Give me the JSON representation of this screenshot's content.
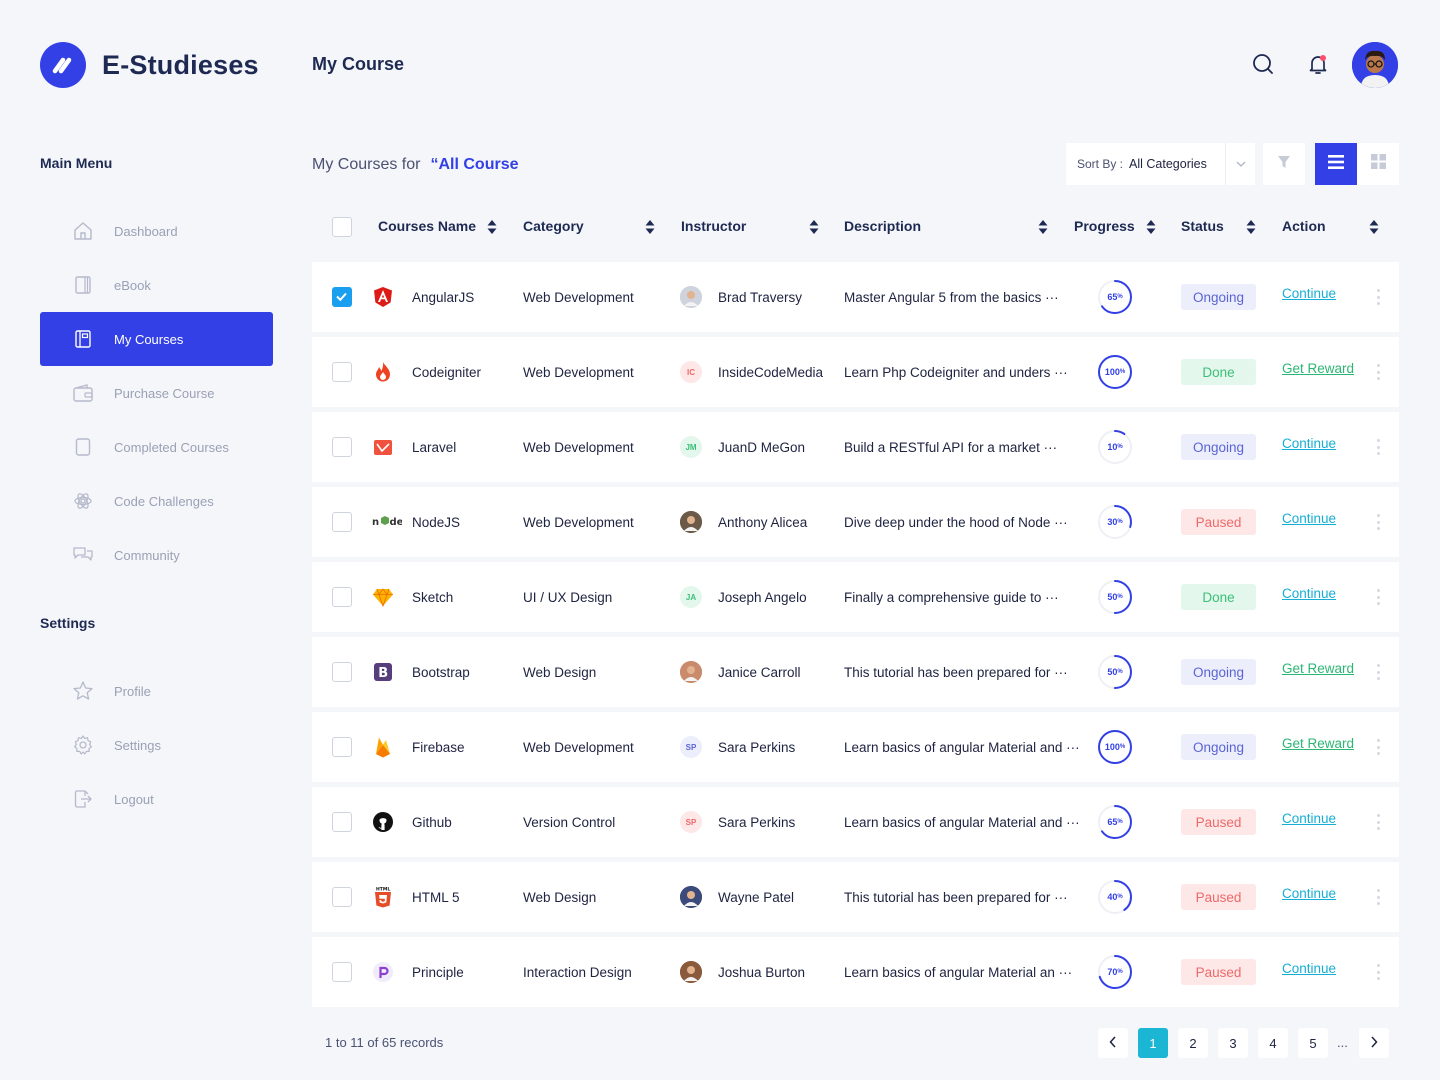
{
  "app": {
    "name": "E-Studieses"
  },
  "header": {
    "title": "My Course",
    "search_icon": "search-icon",
    "bell_icon": "bell-icon"
  },
  "sidebar": {
    "main_heading": "Main Menu",
    "main_items": [
      {
        "label": "Dashboard",
        "icon": "home-icon",
        "active": false
      },
      {
        "label": "eBook",
        "icon": "book-icon",
        "active": false
      },
      {
        "label": "My Courses",
        "icon": "notebook-icon",
        "active": true
      },
      {
        "label": "Purchase Course",
        "icon": "wallet-icon",
        "active": false
      },
      {
        "label": "Completed Courses",
        "icon": "document-icon",
        "active": false
      },
      {
        "label": "Code Challenges",
        "icon": "atom-icon",
        "active": false
      },
      {
        "label": "Community",
        "icon": "chat-icon",
        "active": false
      }
    ],
    "settings_heading": "Settings",
    "settings_items": [
      {
        "label": "Profile",
        "icon": "star-icon"
      },
      {
        "label": "Settings",
        "icon": "gear-icon"
      },
      {
        "label": "Logout",
        "icon": "logout-icon"
      }
    ]
  },
  "content": {
    "courses_for_label": "My Courses for",
    "courses_for_value": "“All Course",
    "sort_label": "Sort By :",
    "sort_value": "All Categories"
  },
  "table": {
    "columns": {
      "name": "Courses Name",
      "category": "Category",
      "instructor": "Instructor",
      "description": "Description",
      "progress": "Progress",
      "status": "Status",
      "action": "Action"
    },
    "rows": [
      {
        "checked": true,
        "course": "AngularJS",
        "icon": "angular-icon",
        "category": "Web Development",
        "instructor": "Brad Traversy",
        "initials": "",
        "avatar_color": "#cfd3de",
        "description": "Master Angular 5 from the basics ···",
        "progress": 65,
        "progress_label": "65",
        "status": "Ongoing",
        "status_type": "ongoing",
        "action": "Continue",
        "action_type": "continue"
      },
      {
        "checked": false,
        "course": "Codeigniter",
        "icon": "flame-icon",
        "category": "Web Development",
        "instructor": "InsideCodeMedia",
        "initials": "IC",
        "avatar_color": "#fde7e7",
        "description": "Learn Php Codeigniter and unders ···",
        "progress": 100,
        "progress_label": "100",
        "status": "Done",
        "status_type": "done",
        "action": "Get Reward",
        "action_type": "reward"
      },
      {
        "checked": false,
        "course": "Laravel",
        "icon": "laravel-icon",
        "category": "Web Development",
        "instructor": "JuanD MeGon",
        "initials": "JM",
        "avatar_color": "#e3f7ec",
        "description": "Build a RESTful API for a market ···",
        "progress": 10,
        "progress_label": "10",
        "status": "Ongoing",
        "status_type": "ongoing",
        "action": "Continue",
        "action_type": "continue"
      },
      {
        "checked": false,
        "course": "NodeJS",
        "icon": "node-icon",
        "category": "Web Development",
        "instructor": "Anthony Alicea",
        "initials": "",
        "avatar_color": "#6b5a48",
        "description": "Dive deep under the hood of Node ···",
        "progress": 30,
        "progress_label": "30",
        "status": "Paused",
        "status_type": "paused",
        "action": "Continue",
        "action_type": "continue"
      },
      {
        "checked": false,
        "course": "Sketch",
        "icon": "diamond-icon",
        "category": "UI / UX Design",
        "instructor": "Joseph Angelo",
        "initials": "JA",
        "avatar_color": "#e3f7ec",
        "description": "Finally a comprehensive guide to ···",
        "progress": 50,
        "progress_label": "50",
        "status": "Done",
        "status_type": "done",
        "action": "Continue",
        "action_type": "continue"
      },
      {
        "checked": false,
        "course": "Bootstrap",
        "icon": "bootstrap-icon",
        "category": "Web Design",
        "instructor": "Janice Carroll",
        "initials": "",
        "avatar_color": "#c98b6b",
        "description": "This tutorial has been prepared for ···",
        "progress": 50,
        "progress_label": "50",
        "status": "Ongoing",
        "status_type": "ongoing",
        "action": "Get Reward",
        "action_type": "reward"
      },
      {
        "checked": false,
        "course": "Firebase",
        "icon": "firebase-icon",
        "category": "Web Development",
        "instructor": "Sara Perkins",
        "initials": "SP",
        "avatar_color": "#eceefc",
        "description": "Learn basics of angular Material and ···",
        "progress": 100,
        "progress_label": "100",
        "status": "Ongoing",
        "status_type": "ongoing",
        "action": "Get Reward",
        "action_type": "reward"
      },
      {
        "checked": false,
        "course": "Github",
        "icon": "github-icon",
        "category": "Version Control",
        "instructor": "Sara Perkins",
        "initials": "SP",
        "avatar_color": "#fde7e7",
        "description": "Learn basics of angular Material and ···",
        "progress": 65,
        "progress_label": "65",
        "status": "Paused",
        "status_type": "paused",
        "action": "Continue",
        "action_type": "continue"
      },
      {
        "checked": false,
        "course": "HTML 5",
        "icon": "html5-icon",
        "category": "Web Design",
        "instructor": "Wayne Patel",
        "initials": "",
        "avatar_color": "#3b4a7a",
        "description": "This tutorial has been prepared for ···",
        "progress": 40,
        "progress_label": "40",
        "status": "Paused",
        "status_type": "paused",
        "action": "Continue",
        "action_type": "continue"
      },
      {
        "checked": false,
        "course": "Principle",
        "icon": "principle-icon",
        "category": "Interaction Design",
        "instructor": "Joshua Burton",
        "initials": "",
        "avatar_color": "#8a5a3c",
        "description": "Learn basics of angular Material an ···",
        "progress": 70,
        "progress_label": "70",
        "status": "Paused",
        "status_type": "paused",
        "action": "Continue",
        "action_type": "continue"
      }
    ]
  },
  "footer": {
    "records_text": "1 to 11 of 65 records",
    "pages": [
      "1",
      "2",
      "3",
      "4",
      "5"
    ],
    "active_page": "1",
    "ellipsis": "..."
  },
  "colors": {
    "primary": "#3340e6",
    "teal": "#1bb6d4",
    "done": "#3bbf78",
    "paused": "#ee6a6a"
  }
}
